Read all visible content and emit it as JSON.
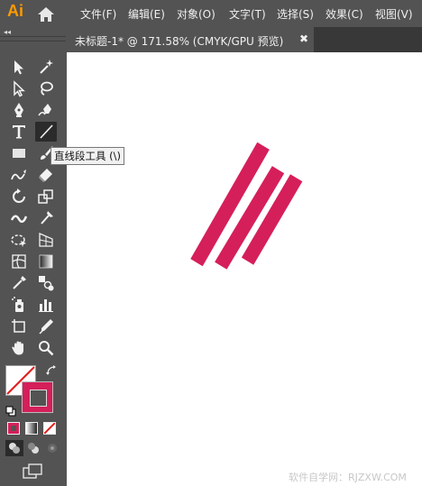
{
  "app": {
    "logo": "Ai"
  },
  "menu": [
    "文件(F)",
    "编辑(E)",
    "对象(O)",
    "文字(T)",
    "选择(S)",
    "效果(C)",
    "视图(V)"
  ],
  "document_tab": {
    "title": "未标题-1* @ 171.58% (CMYK/GPU 预览)",
    "close": "✖"
  },
  "panel": {
    "collapse": "◂◂"
  },
  "tooltip": {
    "text": "直线段工具 (\\)"
  },
  "colors": {
    "fill": "#ffffff",
    "stroke": "#d51f5a",
    "artwork": "#d51f5a",
    "accent": "#ff9a00"
  },
  "canvas_art": {
    "shape": "three parallel diagonal stripes",
    "color": "#d51f5a"
  },
  "tools": [
    "selection-tool",
    "direct-selection-tool",
    "magic-wand-tool",
    "lasso-tool",
    "pen-tool",
    "curvature-tool",
    "type-tool",
    "line-segment-tool",
    "rectangle-tool",
    "eraser-tool",
    "shaper-tool",
    "rotate-tool",
    "scale-tool",
    "width-tool",
    "puppet-warp-tool",
    "free-transform-tool",
    "perspective-grid-tool",
    "mesh-tool",
    "gradient-tool",
    "eyedropper-tool",
    "blend-tool",
    "symbol-sprayer-tool",
    "column-graph-tool",
    "artboard-tool",
    "slice-tool",
    "hand-tool",
    "zoom-tool"
  ],
  "watermark": "软件自学网：RJZXW.COM"
}
